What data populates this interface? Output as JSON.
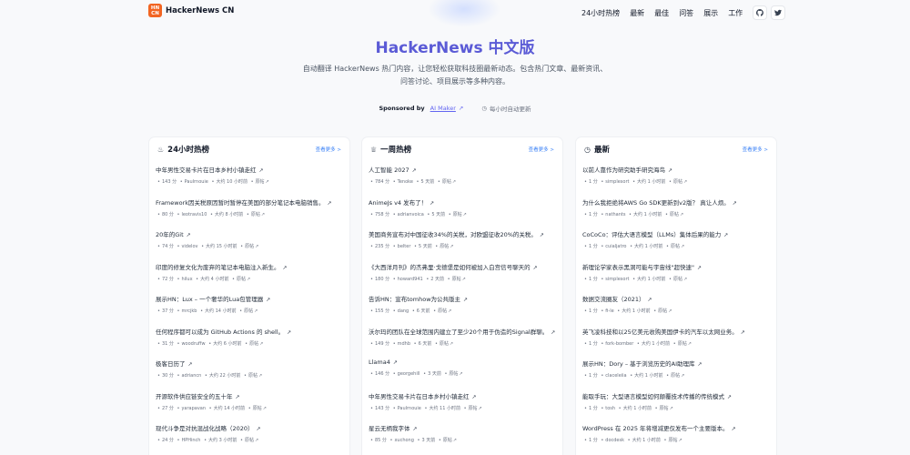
{
  "brand": {
    "logo_mark_top": "HN",
    "logo_mark_bottom": "CN",
    "name": "HackerNews CN"
  },
  "nav": [
    "24小时热榜",
    "最新",
    "最佳",
    "问答",
    "展示",
    "工作"
  ],
  "hero": {
    "title": "HackerNews 中文版",
    "description": "自动翻译 HackerNews 热门内容，让您轻松获取科技圈最新动态。包含热门文章、最新资讯、问答讨论、项目展示等多种内容。"
  },
  "sponsor": {
    "label": "Sponsored by",
    "link": "AI Maker",
    "update_note": "每小时自动更新"
  },
  "panels": [
    {
      "icon": "♨",
      "title": "24小时热榜",
      "more": "查看更多 >",
      "items": [
        {
          "title": "中年男性交易卡片在日本乡村小镇走红",
          "points": "143 分",
          "user": "Paulrnouie",
          "time": "大约 10 小时前",
          "tag": "原帖"
        },
        {
          "title": "Framework因关税原因暂时暂停在美国的部分笔记本电脑销售。",
          "points": "80 分",
          "user": "leotravis10",
          "time": "大约 8 小时前",
          "tag": "原帖"
        },
        {
          "title": "20年的Git",
          "points": "74 分",
          "user": "videlov",
          "time": "大约 15 小时前",
          "tag": "原帖"
        },
        {
          "title": "印度的修复文化为废弃的笔记本电脑注入新生。",
          "points": "72 分",
          "user": "hilux",
          "time": "大约 4 小时前",
          "tag": "原帖"
        },
        {
          "title": "展示HN：Lux – 一个奢华的Lua包管理器",
          "points": "37 分",
          "user": "mrcjkb",
          "time": "大约 14 小时前",
          "tag": "原帖"
        },
        {
          "title": "任何程序都可以成为 GitHub Actions 的 shell。",
          "points": "31 分",
          "user": "woodruffw",
          "time": "大约 6 小时前",
          "tag": "原帖"
        },
        {
          "title": "极客日历了",
          "points": "30 分",
          "user": "adriancn",
          "time": "大约 22 小时前",
          "tag": "原帖"
        },
        {
          "title": "开源软件供应链安全的五十年",
          "points": "27 分",
          "user": "yarapavan",
          "time": "大约 14 小时前",
          "tag": "原帖"
        },
        {
          "title": "现代斗争是对抗混战化战略（2020）",
          "points": "24 分",
          "user": "HPHinch",
          "time": "大约 3 小时前",
          "tag": "原帖"
        }
      ]
    },
    {
      "icon": "♕",
      "title": "一周热榜",
      "more": "查看更多 >",
      "items": [
        {
          "title": "人工智能 2027",
          "points": "784 分",
          "user": "Tenoke",
          "time": "5 天前",
          "tag": "原帖"
        },
        {
          "title": "AnimeJs v4 发布了！",
          "points": "758 分",
          "user": "adrianvoica",
          "time": "5 天前",
          "tag": "原帖"
        },
        {
          "title": "美国商务宣布对中国征收34%的关税，对欧盟征收20%的关税。",
          "points": "235 分",
          "user": "belter",
          "time": "5 天前",
          "tag": "原帖"
        },
        {
          "title": "《大西洋月刊》的杰弗里·戈德堡是如何被加入白宫信号聊天的",
          "points": "180 分",
          "user": "howard941",
          "time": "2 天前",
          "tag": "原帖"
        },
        {
          "title": "告诉HN：宣布tomhow为公共版主",
          "points": "155 分",
          "user": "dang",
          "time": "6 天前",
          "tag": "原帖"
        },
        {
          "title": "沃尔玛的团队在全球范围内建立了至少20个用于伪造的Signal群聊。",
          "points": "149 分",
          "user": "mdhb",
          "time": "6 天前",
          "tag": "原帖"
        },
        {
          "title": "Llama4",
          "points": "146 分",
          "user": "georgehill",
          "time": "3 天前",
          "tag": "原帖"
        },
        {
          "title": "中年男性交易卡片在日本乡村小镇走红",
          "points": "143 分",
          "user": "Paulrnouie",
          "time": "大约 11 小时前",
          "tag": "原帖"
        },
        {
          "title": "星云无柄我字体",
          "points": "85 分",
          "user": "xuchong",
          "time": "3 天前",
          "tag": "原帖"
        }
      ]
    },
    {
      "icon": "◷",
      "title": "最新",
      "more": "查看更多 >",
      "items": [
        {
          "title": "以前人靠作为研究助手研究海鸟",
          "points": "1 分",
          "user": "simplesort",
          "time": "大约 1 小时前",
          "tag": "原帖"
        },
        {
          "title": "为什么我拒绝将AWS Go SDK更新到v2版？ 真让人烦。",
          "points": "1 分",
          "user": "nathants",
          "time": "大约 1 小时前",
          "tag": "原帖"
        },
        {
          "title": "CoCoCo：评估大语言模型（LLMs）集体后果的能力",
          "points": "1 分",
          "user": "cuialjatro",
          "time": "大约 1 小时前",
          "tag": "原帖"
        },
        {
          "title": "新理论学家表示黑洞可能与宇宙线\"超快速\"",
          "points": "1 分",
          "user": "simplesort",
          "time": "大约 1 小时前",
          "tag": "原帖"
        },
        {
          "title": "数据交流圈友（2021）",
          "points": "1 分",
          "user": "fi-le",
          "time": "大约 1 小时前",
          "tag": "原帖"
        },
        {
          "title": "英飞凌科技和以25亿美元收购美国伊卡的汽车以太网业务。",
          "points": "1 分",
          "user": "fork-bomber",
          "time": "大约 1 小时前",
          "tag": "原帖"
        },
        {
          "title": "展示HN：Dory – 基于浏览历史的AI助理库",
          "points": "1 分",
          "user": "claceleiia",
          "time": "大约 1 小时前",
          "tag": "原帖"
        },
        {
          "title": "能取手玩：大型语言模型如何颠覆技术传播的传统模式",
          "points": "1 分",
          "user": "tosh",
          "time": "大约 1 小时前",
          "tag": "原帖"
        },
        {
          "title": "WordPress 在 2025 年将增减更仅发布一个主要版本。",
          "points": "1 分",
          "user": "docdesk",
          "time": "大约 1 小时前",
          "tag": "原帖"
        }
      ]
    }
  ]
}
